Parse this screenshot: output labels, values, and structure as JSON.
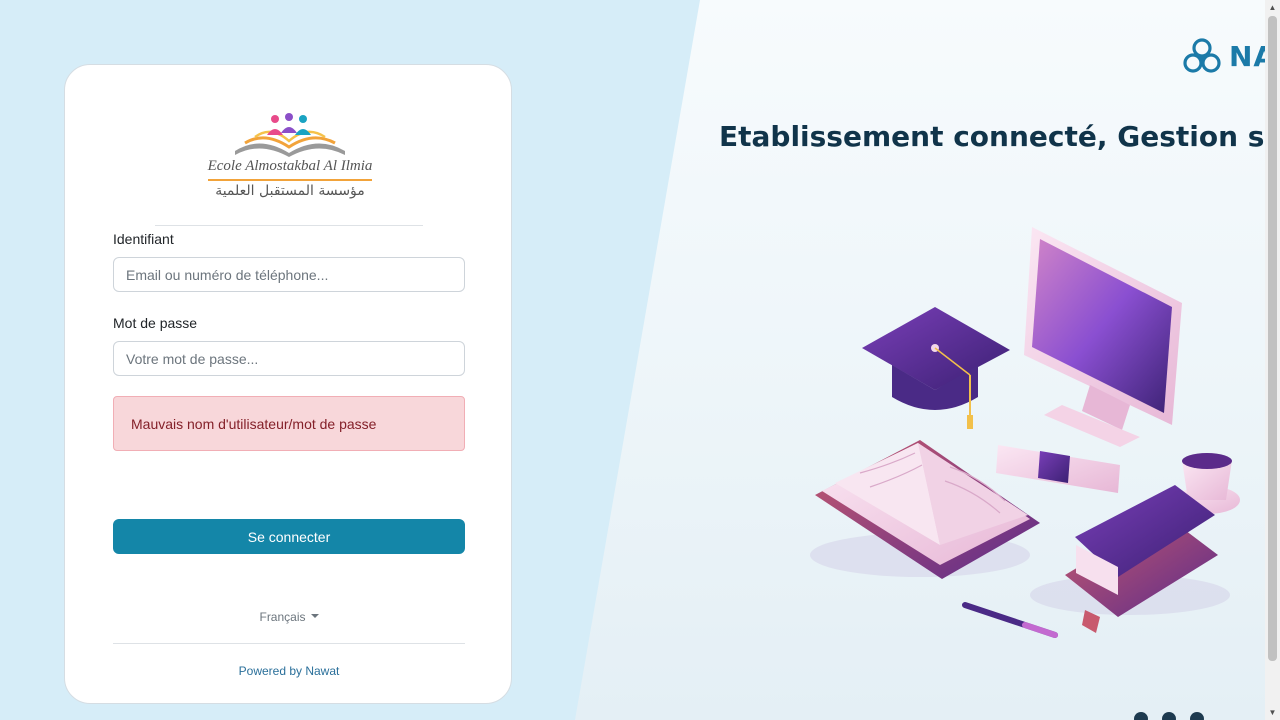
{
  "login": {
    "school_name_latin": "Ecole Almostakbal Al Ilmia",
    "school_name_arabic": "مؤسسة المستقبل العلمية",
    "username_label": "Identifiant",
    "username_placeholder": "Email ou numéro de téléphone...",
    "password_label": "Mot de passe",
    "password_placeholder": "Votre mot de passe...",
    "error_message": "Mauvais nom d'utilisateur/mot de passe",
    "submit_label": "Se connecter",
    "language": "Français",
    "powered_by": "Powered by Nawat"
  },
  "hero": {
    "brand_text": "NA",
    "tagline": "Etablissement connecté, Gestion simp"
  },
  "colors": {
    "primary_button": "#1486a8",
    "error_bg": "#f8d7da",
    "error_text": "#842029",
    "page_bg": "#d6edf8",
    "brand": "#1b7aa8"
  }
}
